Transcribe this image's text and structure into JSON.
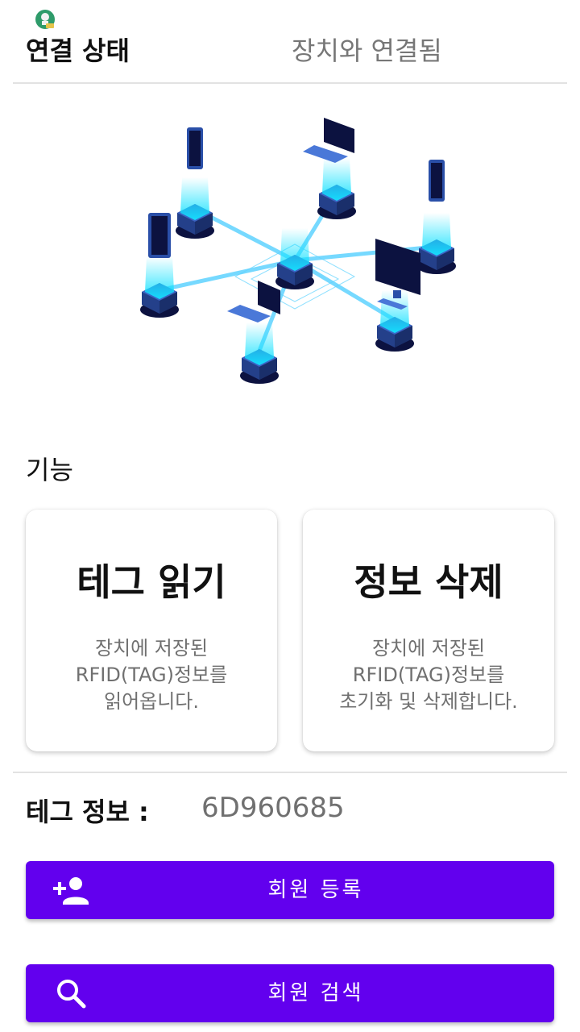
{
  "connection": {
    "label": "연결 상태",
    "value": "장치와 연결됨"
  },
  "features": {
    "title": "기능",
    "read_tag": {
      "title": "테그 읽기",
      "desc": [
        "장치에 저장된",
        "RFID(TAG)정보를",
        "읽어옵니다."
      ]
    },
    "delete_info": {
      "title": "정보 삭제",
      "desc": [
        "장치에 저장된",
        "RFID(TAG)정보를",
        "초기화 및 삭제합니다."
      ]
    }
  },
  "tag_info": {
    "label": "테그 정보 :",
    "value": "6D960685"
  },
  "buttons": {
    "register": {
      "label": "회원 등록",
      "icon": "person-add-icon"
    },
    "search": {
      "label": "회원 검색",
      "icon": "search-icon"
    }
  },
  "colors": {
    "accent": "#6200ee",
    "text_secondary": "#707070",
    "divider": "#e2e2e2"
  }
}
